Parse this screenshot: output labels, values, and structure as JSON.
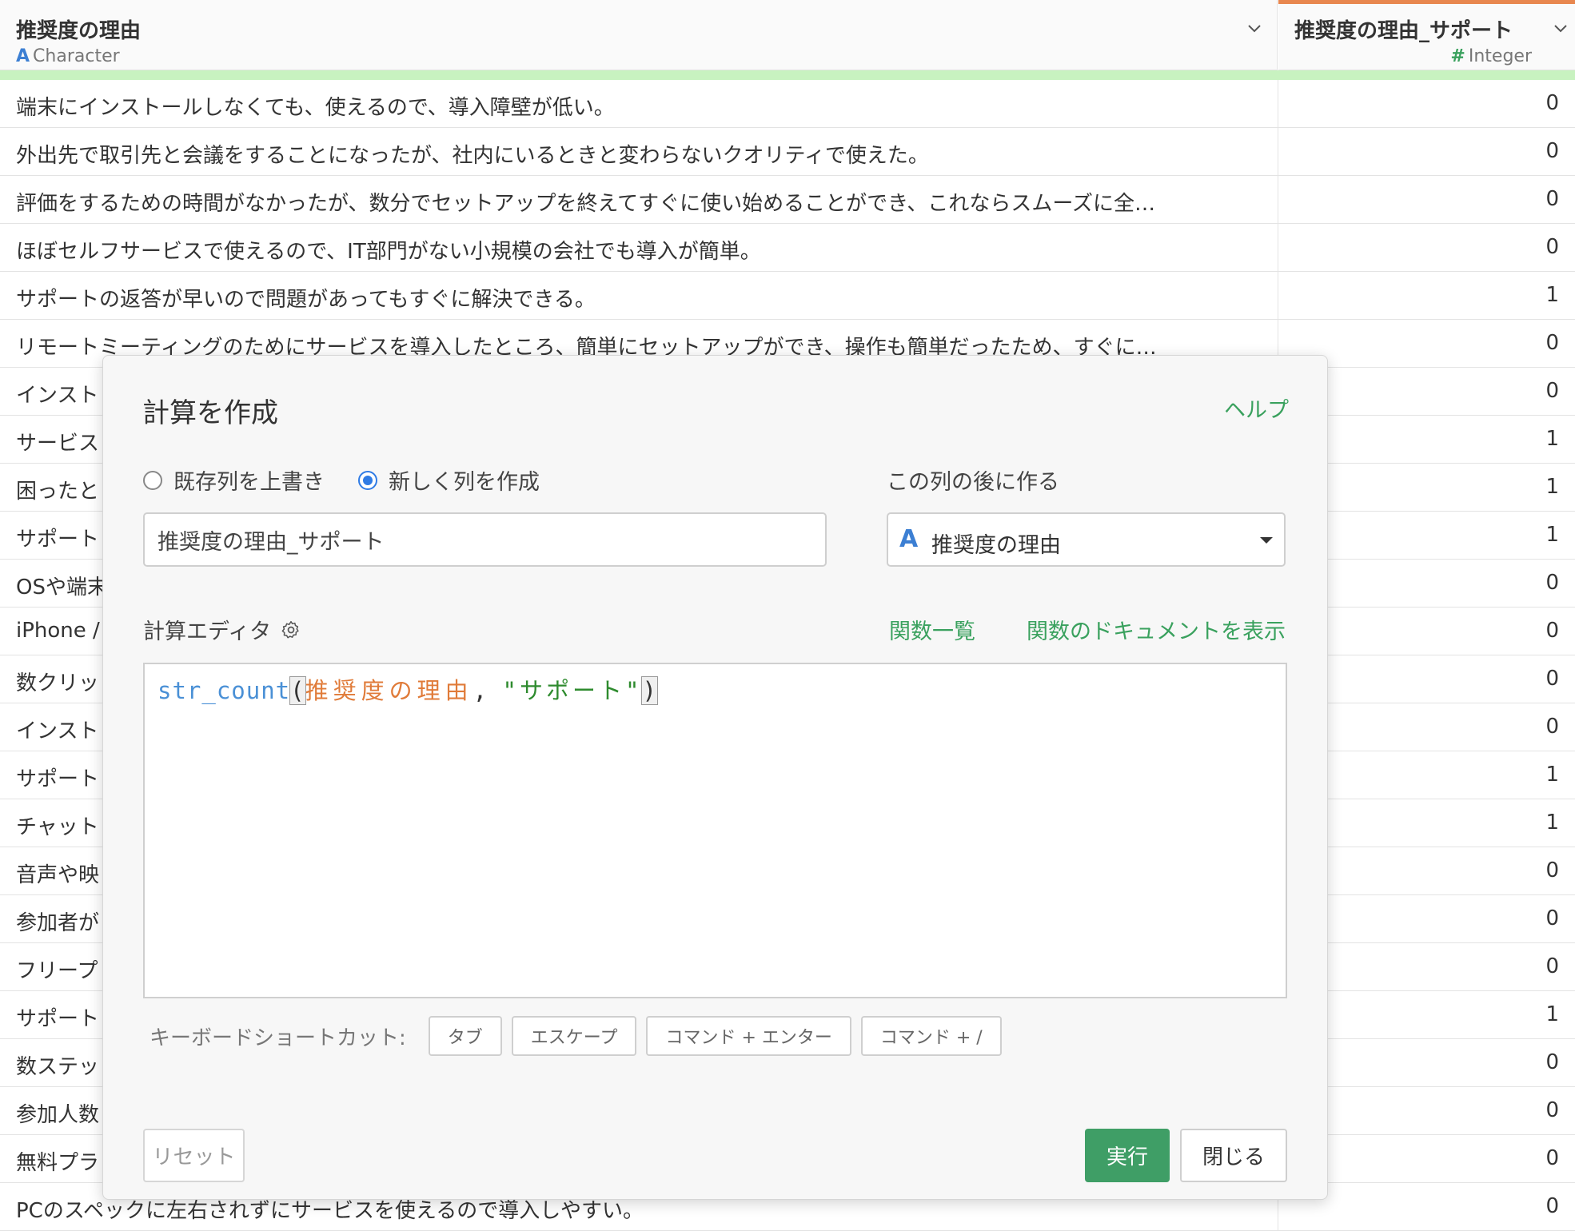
{
  "table": {
    "columns": [
      {
        "name": "推奨度の理由",
        "type_icon": "A",
        "type": "Character"
      },
      {
        "name": "推奨度の理由_サポート",
        "type_icon": "#",
        "type": "Integer"
      }
    ],
    "rows": [
      {
        "text": "端末にインストールしなくても、使えるので、導入障壁が低い。",
        "value": "0"
      },
      {
        "text": "外出先で取引先と会議をすることになったが、社内にいるときと変わらないクオリティで使えた。",
        "value": "0"
      },
      {
        "text": "評価をするための時間がなかったが、数分でセットアップを終えてすぐに使い始めることができ、これならスムーズに全…",
        "value": "0"
      },
      {
        "text": "ほぼセルフサービスで使えるので、IT部門がない小規模の会社でも導入が簡単。",
        "value": "0"
      },
      {
        "text": "サポートの返答が早いので問題があってもすぐに解決できる。",
        "value": "1"
      },
      {
        "text": "リモートミーティングのためにサービスを導入したところ、簡単にセットアップができ、操作も簡単だったため、すぐに…",
        "value": "0"
      },
      {
        "text": "インスト",
        "value": "0"
      },
      {
        "text": "サービス",
        "value": "1"
      },
      {
        "text": "困ったと",
        "value": "1"
      },
      {
        "text": "サポート",
        "value": "1"
      },
      {
        "text": "OSや端末",
        "value": "0"
      },
      {
        "text": "iPhone / ",
        "value": "0"
      },
      {
        "text": "数クリッ",
        "value": "0"
      },
      {
        "text": "インスト",
        "value": "0"
      },
      {
        "text": "サポート",
        "value": "1"
      },
      {
        "text": "チャット",
        "value": "1"
      },
      {
        "text": "音声や映",
        "value": "0"
      },
      {
        "text": "参加者が",
        "value": "0"
      },
      {
        "text": "フリープ",
        "value": "0"
      },
      {
        "text": "サポート",
        "value": "1"
      },
      {
        "text": "数ステッ",
        "value": "0"
      },
      {
        "text": "参加人数",
        "value": "0"
      },
      {
        "text": "無料プラ",
        "value": "0"
      },
      {
        "text": "PCのスペックに左右されずにサービスを使えるので導入しやすい。",
        "value": "0"
      }
    ]
  },
  "dialog": {
    "title": "計算を作成",
    "help": "ヘルプ",
    "radio_overwrite": "既存列を上書き",
    "radio_new": "新しく列を作成",
    "selected_mode": "new",
    "after_label": "この列の後に作る",
    "column_name": "推奨度の理由_サポート",
    "after_column_icon": "A",
    "after_column": "推奨度の理由",
    "editor_label": "計算エディタ",
    "function_list": "関数一覧",
    "function_docs": "関数のドキュメントを表示",
    "code": {
      "fn": "str_count",
      "open": "(",
      "column": "推奨度の理由",
      "comma": ", ",
      "string": "\"サポート\"",
      "close": ")"
    },
    "shortcuts_label": "キーボードショートカット:",
    "shortcuts": [
      "タブ",
      "エスケープ",
      "コマンド + エンター",
      "コマンド + /"
    ],
    "reset": "リセット",
    "run": "実行",
    "close": "閉じる"
  },
  "colors": {
    "accent_green": "#3aa15e",
    "run_button": "#3f9e66",
    "column_accent": "#e8874f",
    "header_bar": "#c8f2c0",
    "radio_selected": "#2f7be5"
  }
}
